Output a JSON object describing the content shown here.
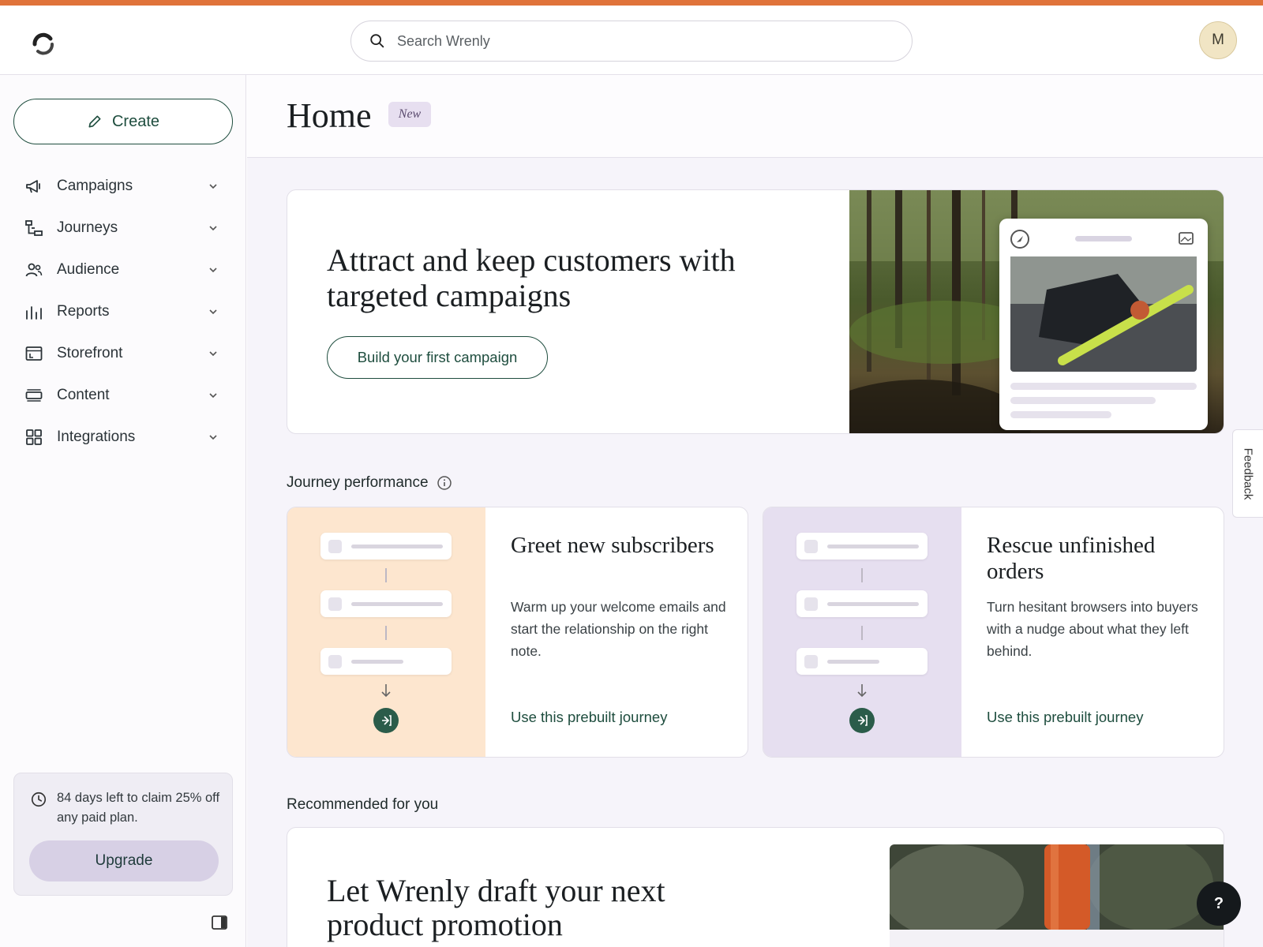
{
  "header": {
    "search_placeholder": "Search Wrenly",
    "avatar_initial": "M"
  },
  "sidebar": {
    "create_label": "Create",
    "items": [
      {
        "label": "Campaigns",
        "icon": "megaphone-icon"
      },
      {
        "label": "Journeys",
        "icon": "journey-icon"
      },
      {
        "label": "Audience",
        "icon": "people-icon"
      },
      {
        "label": "Reports",
        "icon": "bar-chart-icon"
      },
      {
        "label": "Storefront",
        "icon": "storefront-icon"
      },
      {
        "label": "Content",
        "icon": "content-icon"
      },
      {
        "label": "Integrations",
        "icon": "grid-icon"
      }
    ],
    "promo_text": "84 days left to claim 25% off any paid plan.",
    "upgrade_label": "Upgrade"
  },
  "page": {
    "title": "Home",
    "badge": "New"
  },
  "hero": {
    "title": "Attract and keep customers with targeted campaigns",
    "button_label": "Build your first campaign"
  },
  "journey_performance": {
    "title": "Journey performance",
    "cards": [
      {
        "title": "Greet new subscribers",
        "description": "Warm up your welcome emails and start the relationship on the right note.",
        "link": "Use this prebuilt journey",
        "art_color": "#fde6cf"
      },
      {
        "title": "Rescue unfinished orders",
        "description": "Turn hesitant browsers into buyers with a nudge about what they left behind.",
        "link": "Use this prebuilt journey",
        "art_color": "#e6dff0"
      }
    ]
  },
  "recommended": {
    "title": "Recommended for you",
    "card_title": "Let Wrenly draft your next product promotion"
  },
  "feedback_label": "Feedback",
  "help_label": "?",
  "colors": {
    "accent": "#e0733a",
    "brand_green": "#1e4d3e"
  }
}
